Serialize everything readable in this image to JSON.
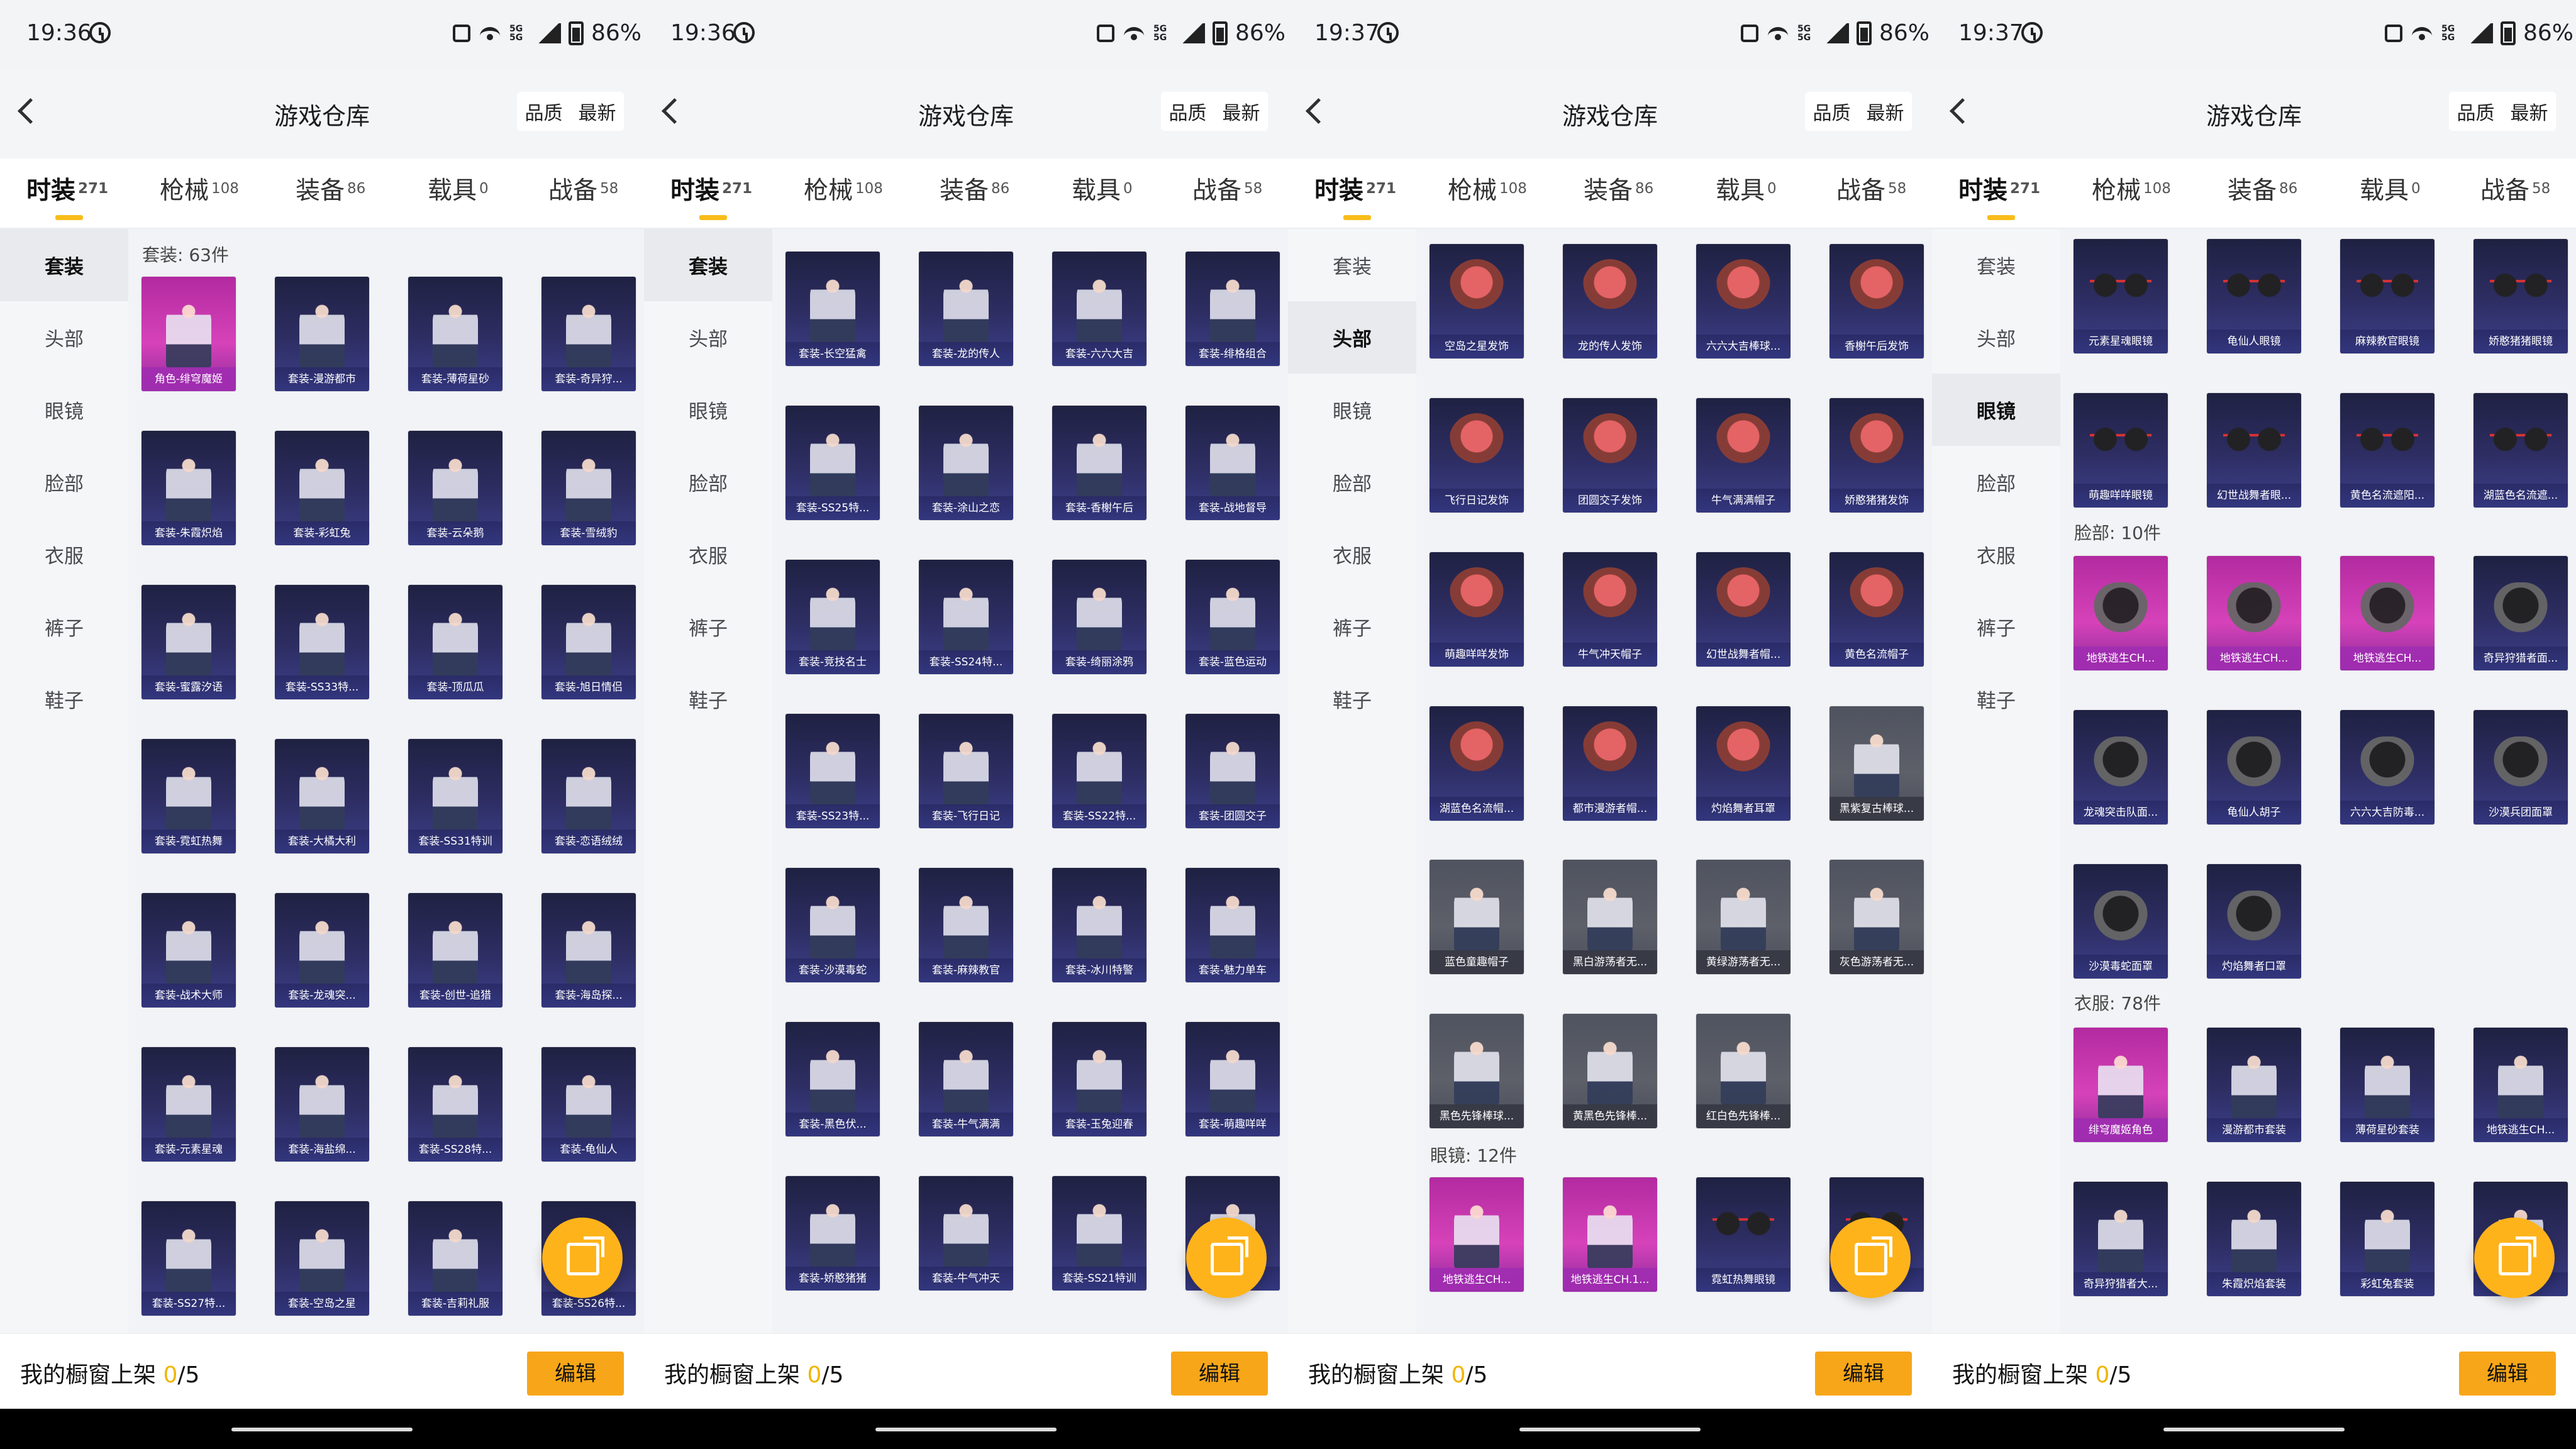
{
  "screens": [
    {
      "status": {
        "time": "19:36",
        "battery": "86%",
        "network": "5G 5G"
      },
      "nav": {
        "title": "游戏仓库",
        "sort": [
          "品质",
          "最新"
        ]
      },
      "tabs": [
        {
          "label": "时装",
          "count": "271"
        },
        {
          "label": "枪械",
          "count": "108"
        },
        {
          "label": "装备",
          "count": "86"
        },
        {
          "label": "载具",
          "count": "0"
        },
        {
          "label": "战备",
          "count": "58"
        }
      ],
      "side": [
        "套装",
        "头部",
        "眼镜",
        "脸部",
        "衣服",
        "裤子",
        "鞋子"
      ],
      "content": {
        "sections": [
          {
            "title": "套装: 63件"
          }
        ],
        "items": [
          "角色-绯穹魔姬",
          "套装-漫游都市",
          "套装-薄荷星砂",
          "套装-奇异狩...",
          "套装-朱霞炽焰",
          "套装-彩虹兔",
          "套装-云朵鹅",
          "套装-雪绒豹",
          "套装-蜜露汐语",
          "套装-SS33特...",
          "套装-顶瓜瓜",
          "套装-旭日情侣",
          "套装-霓虹热舞",
          "套装-大橘大利",
          "套装-SS31特训",
          "套装-恋语绒绒",
          "套装-战术大师",
          "套装-龙魂突...",
          "套装-创世-追猎",
          "套装-海岛探...",
          "套装-元素星魂",
          "套装-海盐绵...",
          "套装-SS28特...",
          "套装-龟仙人",
          "套装-SS27特...",
          "套装-空岛之星",
          "套装-吉莉礼服",
          "套装-SS26特..."
        ]
      },
      "bottom": {
        "label": "我的橱窗上架",
        "count": "0",
        "total": "/5",
        "button": "编辑"
      }
    },
    {
      "status": {
        "time": "19:36",
        "battery": "86%",
        "network": "5G 5G"
      },
      "nav": {
        "title": "游戏仓库",
        "sort": [
          "品质",
          "最新"
        ]
      },
      "tabs": [
        {
          "label": "时装",
          "count": "271"
        },
        {
          "label": "枪械",
          "count": "108"
        },
        {
          "label": "装备",
          "count": "86"
        },
        {
          "label": "载具",
          "count": "0"
        },
        {
          "label": "战备",
          "count": "58"
        }
      ],
      "side": [
        "套装",
        "头部",
        "眼镜",
        "脸部",
        "衣服",
        "裤子",
        "鞋子"
      ],
      "content": {
        "sections": [],
        "items": [
          "套装-长空猛禽",
          "套装-龙的传人",
          "套装-六六大吉",
          "套装-绯格组合",
          "套装-SS25特...",
          "套装-涂山之恋",
          "套装-香榭午后",
          "套装-战地督导",
          "套装-竞技名士",
          "套装-SS24特...",
          "套装-绮丽涂鸦",
          "套装-蓝色运动",
          "套装-SS23特...",
          "套装-飞行日记",
          "套装-SS22特...",
          "套装-团圆交子",
          "套装-沙漠毒蛇",
          "套装-麻辣教官",
          "套装-冰川特警",
          "套装-魅力单车",
          "套装-黑色伏...",
          "套装-牛气满满",
          "套装-玉兔迎春",
          "套装-萌趣咩咩",
          "套装-娇憨猪猪",
          "套装-牛气冲天",
          "套装-SS21特训",
          "套装-..."
        ]
      },
      "bottom": {
        "label": "我的橱窗上架",
        "count": "0",
        "total": "/5",
        "button": "编辑"
      }
    },
    {
      "status": {
        "time": "19:37",
        "battery": "86%",
        "network": "5G 5G"
      },
      "nav": {
        "title": "游戏仓库",
        "sort": [
          "品质",
          "最新"
        ]
      },
      "tabs": [
        {
          "label": "时装",
          "count": "271"
        },
        {
          "label": "枪械",
          "count": "108"
        },
        {
          "label": "装备",
          "count": "86"
        },
        {
          "label": "载具",
          "count": "0"
        },
        {
          "label": "战备",
          "count": "58"
        }
      ],
      "side": [
        "套装",
        "头部",
        "眼镜",
        "脸部",
        "衣服",
        "裤子",
        "鞋子"
      ],
      "content": {
        "sections": [
          {
            "title": "眼镜: 12件"
          }
        ],
        "items": [
          "空岛之星发饰",
          "龙的传人发饰",
          "六六大吉棒球...",
          "香榭午后发饰",
          "飞行日记发饰",
          "团圆交子发饰",
          "牛气满满帽子",
          "娇憨猪猪发饰",
          "萌趣咩咩发饰",
          "牛气冲天帽子",
          "幻世战舞者帽...",
          "黄色名流帽子",
          "湖蓝色名流帽...",
          "都市漫游者帽...",
          "灼焰舞者耳罩",
          "黑紫复古棒球...",
          "蓝色童趣帽子",
          "黑白游荡者无...",
          "黄绿游荡者无...",
          "灰色游荡者无...",
          "黑色先锋棒球...",
          "黄黑色先锋棒...",
          "红白色先锋棒...",
          "地铁逃生CH...",
          "地铁逃生CH.1...",
          "霓虹热舞眼镜",
          "..."
        ]
      },
      "bottom": {
        "label": "我的橱窗上架",
        "count": "0",
        "total": "/5",
        "button": "编辑"
      }
    },
    {
      "status": {
        "time": "19:37",
        "battery": "86%",
        "network": "5G 5G"
      },
      "nav": {
        "title": "游戏仓库",
        "sort": [
          "品质",
          "最新"
        ]
      },
      "tabs": [
        {
          "label": "时装",
          "count": "271"
        },
        {
          "label": "枪械",
          "count": "108"
        },
        {
          "label": "装备",
          "count": "86"
        },
        {
          "label": "载具",
          "count": "0"
        },
        {
          "label": "战备",
          "count": "58"
        }
      ],
      "side": [
        "套装",
        "头部",
        "眼镜",
        "脸部",
        "衣服",
        "裤子",
        "鞋子"
      ],
      "content": {
        "sections": [
          {
            "title": "脸部: 10件"
          },
          {
            "title": "衣服: 78件"
          }
        ],
        "items": [
          "元素星魂眼镜",
          "龟仙人眼镜",
          "麻辣教官眼镜",
          "娇憨猪猪眼镜",
          "萌趣咩咩眼镜",
          "幻世战舞者眼...",
          "黄色名流遮阳...",
          "湖蓝色名流遮...",
          "地铁逃生CH...",
          "地铁逃生CH...",
          "地铁逃生CH...",
          "奇异狩猎者面...",
          "龙魂突击队面...",
          "龟仙人胡子",
          "六六大吉防毒...",
          "沙漠兵团面罩",
          "沙漠毒蛇面罩",
          "灼焰舞者口罩",
          "绯穹魔姬角色",
          "漫游都市套装",
          "薄荷星砂套装",
          "地铁逃生CH...",
          "奇异狩猎者大...",
          "朱霞炽焰套装",
          "彩虹兔套装",
          "..."
        ]
      },
      "bottom": {
        "label": "我的橱窗上架",
        "count": "0",
        "total": "/5",
        "button": "编辑"
      }
    }
  ]
}
